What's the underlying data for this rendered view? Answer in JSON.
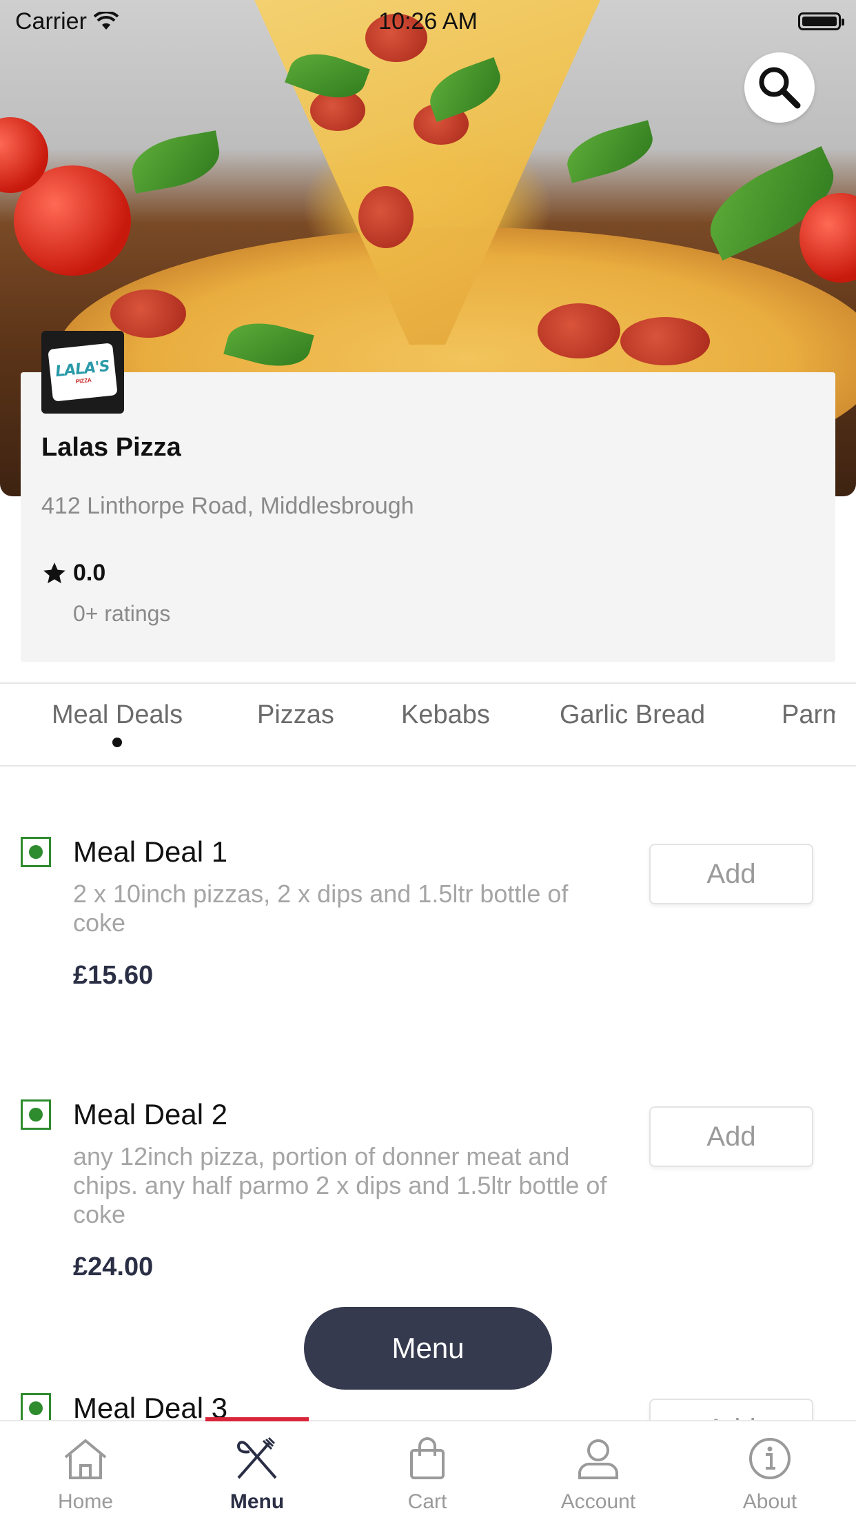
{
  "status_bar": {
    "carrier": "Carrier",
    "time": "10:26 AM"
  },
  "restaurant": {
    "logo_text": "LALA'S",
    "logo_sub": "PIZZA",
    "name": "Lalas Pizza",
    "address": "412 Linthorpe Road, Middlesbrough",
    "rating": "0.0",
    "ratings_count": "0+ ratings"
  },
  "tabs": [
    {
      "label": "Meal Deals",
      "active": true
    },
    {
      "label": "Pizzas"
    },
    {
      "label": "Kebabs"
    },
    {
      "label": "Garlic Bread"
    },
    {
      "label": "Parmo"
    }
  ],
  "items": [
    {
      "name": "Meal Deal 1",
      "description": "2 x 10inch pizzas, 2 x dips and 1.5ltr bottle of coke",
      "price": "£15.60",
      "add_label": "Add"
    },
    {
      "name": "Meal Deal 2",
      "description": "any 12inch pizza, portion of donner meat and chips. any half parmo 2 x dips and 1.5ltr bottle of coke",
      "price": "£24.00",
      "add_label": "Add"
    },
    {
      "name": "Meal Deal 3",
      "add_label": "Add"
    }
  ],
  "menu_button": "Menu",
  "bottom_nav": [
    {
      "label": "Home",
      "icon": "home-icon"
    },
    {
      "label": "Menu",
      "icon": "fork-knife-icon",
      "active": true
    },
    {
      "label": "Cart",
      "icon": "bag-icon"
    },
    {
      "label": "Account",
      "icon": "user-icon"
    },
    {
      "label": "About",
      "icon": "info-icon"
    }
  ],
  "colors": {
    "accent": "#d8253a",
    "dark": "#363a4f",
    "veg": "#2e8b2e"
  }
}
